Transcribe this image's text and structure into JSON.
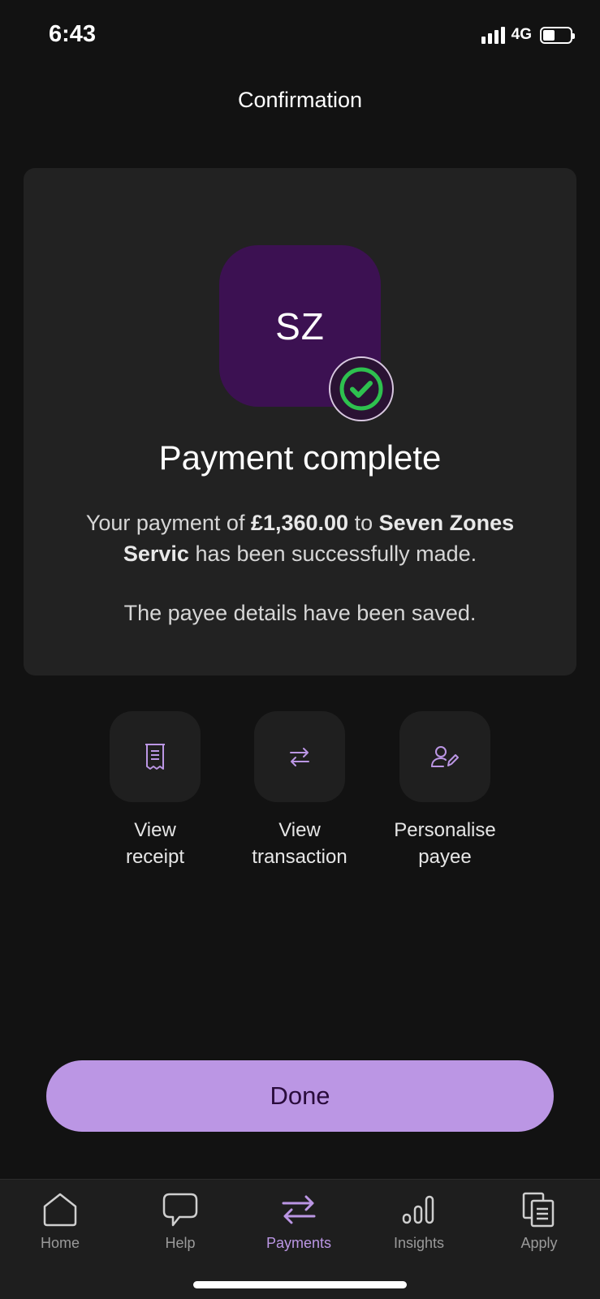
{
  "status_bar": {
    "time": "6:43",
    "network": "4G",
    "battery_level": 0.45
  },
  "header": {
    "title": "Confirmation"
  },
  "confirmation": {
    "avatar_initials": "SZ",
    "avatar_color": "#3c1152",
    "success_icon": "check-circle-icon",
    "success_color": "#2ec04f",
    "title": "Payment complete",
    "desc_prefix": "Your payment of ",
    "amount": "£1,360.00",
    "desc_middle": " to ",
    "payee": "Seven Zones Servic",
    "desc_suffix": " has been successfully made.",
    "note": "The payee details have been saved."
  },
  "actions": [
    {
      "icon": "receipt-icon",
      "line1": "View",
      "line2": "receipt"
    },
    {
      "icon": "transfer-arrows-icon",
      "line1": "View",
      "line2": "transaction"
    },
    {
      "icon": "user-edit-icon",
      "line1": "Personalise",
      "line2": "payee"
    }
  ],
  "done_button": {
    "label": "Done",
    "color": "#bb96e4"
  },
  "tab_bar": {
    "active": "Payments",
    "accent_color": "#bb96e4",
    "items": [
      {
        "label": "Home",
        "icon": "home-icon"
      },
      {
        "label": "Help",
        "icon": "chat-bubble-icon"
      },
      {
        "label": "Payments",
        "icon": "transfer-arrows-icon"
      },
      {
        "label": "Insights",
        "icon": "insights-chart-icon"
      },
      {
        "label": "Apply",
        "icon": "documents-icon"
      }
    ]
  }
}
